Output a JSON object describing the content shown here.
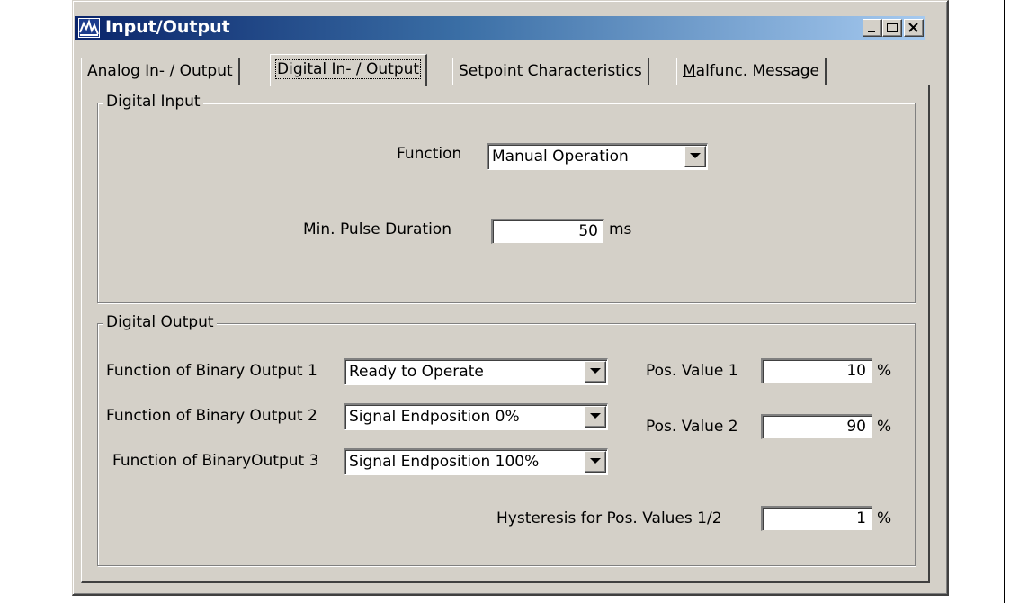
{
  "window": {
    "title": "Input/Output"
  },
  "tabs": [
    {
      "label": "Analog In- / Output"
    },
    {
      "label": "Digital In- / Output",
      "active": true
    },
    {
      "label": "Setpoint Characteristics"
    },
    {
      "label_rest": "alfunc. Message",
      "mnemonic": "M"
    }
  ],
  "digital_input": {
    "legend": "Digital Input",
    "function_label": "Function",
    "function_value": "Manual Operation",
    "pulse_label": "Min. Pulse Duration",
    "pulse_value": "50",
    "pulse_unit": "ms"
  },
  "digital_output": {
    "legend": "Digital Output",
    "bo1_label": "Function of Binary Output 1",
    "bo1_value": "Ready to Operate",
    "bo2_label": "Function of Binary Output 2",
    "bo2_value": "Signal Endposition 0%",
    "bo3_label": "Function of BinaryOutput 3",
    "bo3_value": "Signal Endposition 100%",
    "pos1_label": "Pos. Value 1",
    "pos1_value": "10",
    "pos2_label": "Pos. Value 2",
    "pos2_value": "90",
    "hyst_label": "Hysteresis for Pos. Values 1/2",
    "hyst_value": "1",
    "unit_percent": "%"
  },
  "colors": {
    "face": "#d4d0c8",
    "title_start": "#0a246a",
    "title_end": "#a6caf0"
  },
  "icons": [
    "app-icon",
    "minimize-icon",
    "maximize-icon",
    "close-icon",
    "dropdown-arrow-icon"
  ]
}
